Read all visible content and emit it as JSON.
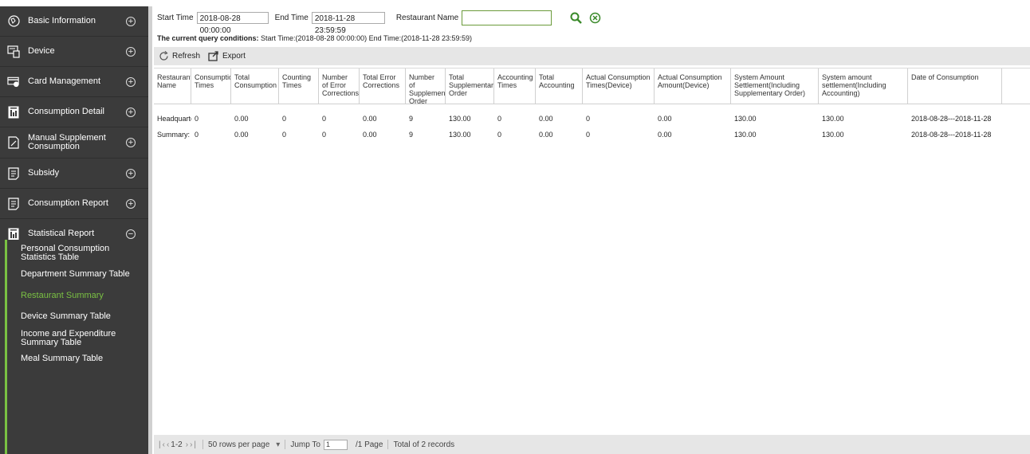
{
  "sidebar": {
    "items": [
      {
        "label": "Basic Information",
        "icon": "globe-icon",
        "toggle": "+"
      },
      {
        "label": "Device",
        "icon": "device-icon",
        "toggle": "+"
      },
      {
        "label": "Card Management",
        "icon": "card-icon",
        "toggle": "+"
      },
      {
        "label": "Consumption Detail",
        "icon": "report-bars-icon",
        "toggle": "+"
      },
      {
        "label": "Manual Supplement Consumption",
        "icon": "edit-doc-icon",
        "toggle": "+"
      },
      {
        "label": "Subsidy",
        "icon": "doc-lines-icon",
        "toggle": "+"
      },
      {
        "label": "Consumption Report",
        "icon": "doc-lines-icon",
        "toggle": "+"
      },
      {
        "label": "Statistical Report",
        "icon": "report-bars-icon",
        "toggle": "−"
      }
    ],
    "subitems": [
      {
        "label": "Personal Consumption Statistics Table"
      },
      {
        "label": "Department Summary Table"
      },
      {
        "label": "Restaurant Summary",
        "active": true
      },
      {
        "label": "Device Summary Table"
      },
      {
        "label": "Income and Expenditure Summary Table"
      },
      {
        "label": "Meal Summary Table"
      }
    ],
    "accent_color": "#7ac143"
  },
  "query": {
    "start_label": "Start Time",
    "start_value": "2018-08-28 00:00:00",
    "end_label": "End Time",
    "end_value": "2018-11-28 23:59:59",
    "restaurant_label": "Restaurant Name",
    "restaurant_value": ""
  },
  "conditions": {
    "prefix": "The current query conditions:",
    "text": " Start Time:(2018-08-28 00:00:00)  End Time:(2018-11-28 23:59:59)"
  },
  "toolbar": {
    "refresh_label": "Refresh",
    "export_label": "Export"
  },
  "table": {
    "columns": [
      "Restaurant Name",
      "Consumption Times",
      "Total Consumption",
      "Counting Times",
      "Number of Error Corrections",
      "Total Error Corrections",
      "Number of Supplementary Order",
      "Total Supplementary Order",
      "Accounting Times",
      "Total Accounting",
      "Actual Consumption Times(Device)",
      "Actual Consumption Amount(Device)",
      "System Amount Settlement(Including Supplementary Order)",
      "System amount settlement(Including Accounting)",
      "Date of Consumption"
    ],
    "rows": [
      [
        "Headquarters",
        "0",
        "0.00",
        "0",
        "0",
        "0.00",
        "9",
        "130.00",
        "0",
        "0.00",
        "0",
        "0.00",
        "130.00",
        "130.00",
        "2018-08-28---2018-11-28"
      ],
      [
        "Summary:",
        "0",
        "0.00",
        "0",
        "0",
        "0.00",
        "9",
        "130.00",
        "0",
        "0.00",
        "0",
        "0.00",
        "130.00",
        "130.00",
        "2018-08-28---2018-11-28"
      ]
    ]
  },
  "pager": {
    "range": "1-2",
    "rows_per_page": "50 rows per page",
    "jump_label": "Jump To",
    "jump_value": "1",
    "page_suffix": "/1 Page",
    "total": "Total of 2 records"
  }
}
